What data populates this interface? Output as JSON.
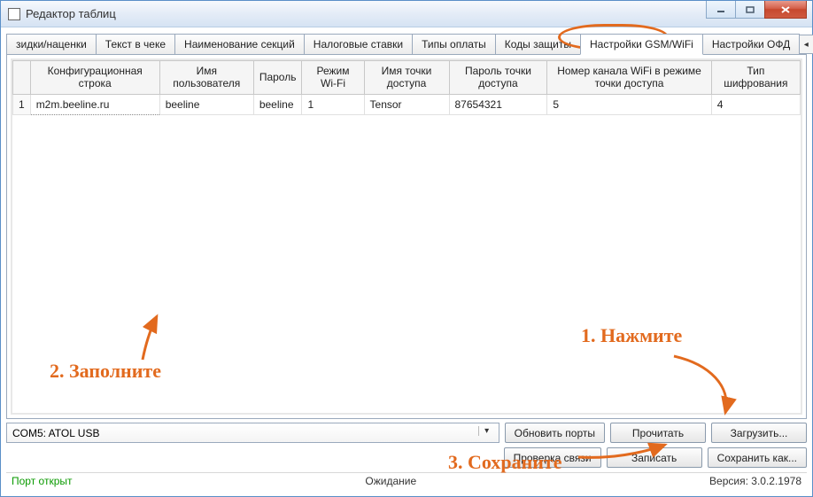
{
  "window": {
    "title": "Редактор таблиц"
  },
  "tabs": [
    {
      "label": "зидки/наценки"
    },
    {
      "label": "Текст в чеке"
    },
    {
      "label": "Наименование секций"
    },
    {
      "label": "Налоговые ставки"
    },
    {
      "label": "Типы оплаты"
    },
    {
      "label": "Коды защиты"
    },
    {
      "label": "Настройки GSM/WiFi",
      "active": true
    },
    {
      "label": "Настройки ОФД"
    }
  ],
  "columns": [
    "Конфигурационная строка",
    "Имя пользователя",
    "Пароль",
    "Режим Wi-Fi",
    "Имя точки доступа",
    "Пароль точки доступа",
    "Номер канала WiFi в режиме точки доступа",
    "Тип шифрования"
  ],
  "rows": [
    {
      "num": "1",
      "config_str": "m2m.beeline.ru",
      "username": "beeline",
      "password": "beeline",
      "wifi_mode": "1",
      "ap_name": "Tensor",
      "ap_password": "87654321",
      "wifi_channel": "5",
      "encryption": "4"
    }
  ],
  "combo": {
    "selected": "COM5: ATOL USB"
  },
  "buttons": {
    "refresh_ports": "Обновить порты",
    "read": "Прочитать",
    "load": "Загрузить...",
    "check_conn": "Проверка связи",
    "write": "Записать",
    "save_as": "Сохранить как..."
  },
  "status": {
    "left": "Порт открыт",
    "center": "Ожидание",
    "right": "Версия: 3.0.2.1978"
  },
  "annotations": {
    "step1": "1. Нажмите",
    "step2": "2. Заполните",
    "step3": "3. Сохраните"
  }
}
